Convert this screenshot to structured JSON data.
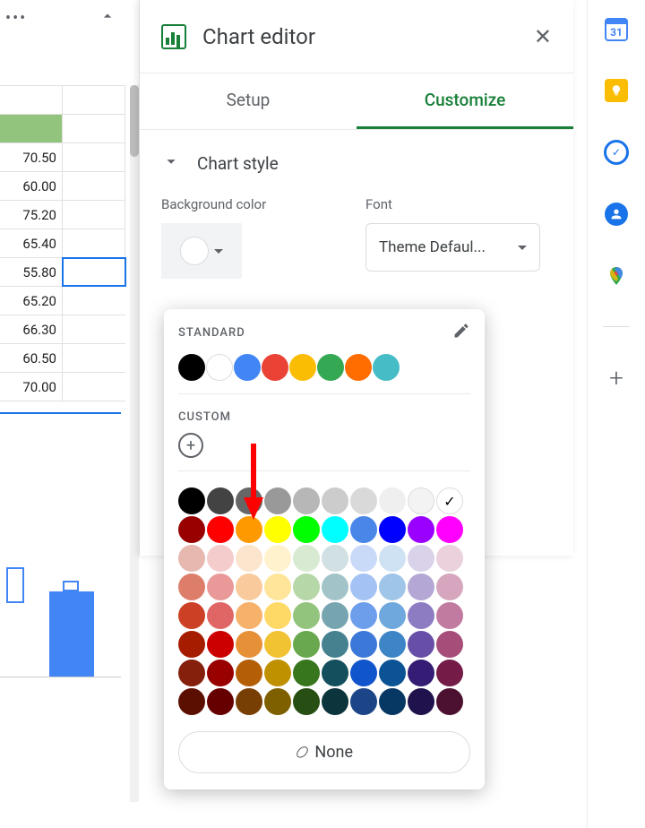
{
  "spreadsheet": {
    "cells": [
      "70.50",
      "60.00",
      "75.20",
      "65.40",
      "55.80",
      "65.20",
      "66.30",
      "60.50",
      "70.00"
    ]
  },
  "editor": {
    "title": "Chart editor",
    "tabs": {
      "setup": "Setup",
      "customize": "Customize"
    },
    "section": "Chart style",
    "bg_label": "Background color",
    "font_label": "Font",
    "font_value": "Theme Defaul..."
  },
  "picker": {
    "standard_label": "STANDARD",
    "custom_label": "CUSTOM",
    "none_label": "None",
    "standard_colors": [
      "#000000",
      "#ffffff",
      "#4285f4",
      "#ea4335",
      "#fbbc04",
      "#34a853",
      "#ff6d01",
      "#46bdc6"
    ],
    "gray_row": [
      "#000000",
      "#434343",
      "#666666",
      "#999999",
      "#b7b7b7",
      "#cccccc",
      "#d9d9d9",
      "#efefef",
      "#f3f3f3",
      "#ffffff"
    ],
    "hue_row": [
      "#980000",
      "#ff0000",
      "#ff9900",
      "#ffff00",
      "#00ff00",
      "#00ffff",
      "#4a86e8",
      "#0000ff",
      "#9900ff",
      "#ff00ff"
    ],
    "grid": [
      [
        "#e6b8af",
        "#f4cccc",
        "#fce5cd",
        "#fff2cc",
        "#d9ead3",
        "#d0e0e3",
        "#c9daf8",
        "#cfe2f3",
        "#d9d2e9",
        "#ead1dc"
      ],
      [
        "#dd7e6b",
        "#ea9999",
        "#f9cb9c",
        "#ffe599",
        "#b6d7a8",
        "#a2c4c9",
        "#a4c2f4",
        "#9fc5e8",
        "#b4a7d6",
        "#d5a6bd"
      ],
      [
        "#cc4125",
        "#e06666",
        "#f6b26b",
        "#ffd966",
        "#93c47d",
        "#76a5af",
        "#6d9eeb",
        "#6fa8dc",
        "#8e7cc3",
        "#c27ba0"
      ],
      [
        "#a61c00",
        "#cc0000",
        "#e69138",
        "#f1c232",
        "#6aa84f",
        "#45818e",
        "#3c78d8",
        "#3d85c6",
        "#674ea7",
        "#a64d79"
      ],
      [
        "#85200c",
        "#990000",
        "#b45f06",
        "#bf9000",
        "#38761d",
        "#134f5c",
        "#1155cc",
        "#0b5394",
        "#351c75",
        "#741b47"
      ],
      [
        "#5b0f00",
        "#660000",
        "#783f04",
        "#7f6000",
        "#274e13",
        "#0c343d",
        "#1c4587",
        "#073763",
        "#20124d",
        "#4c1130"
      ]
    ]
  },
  "side": {
    "calendar_day": "31"
  }
}
